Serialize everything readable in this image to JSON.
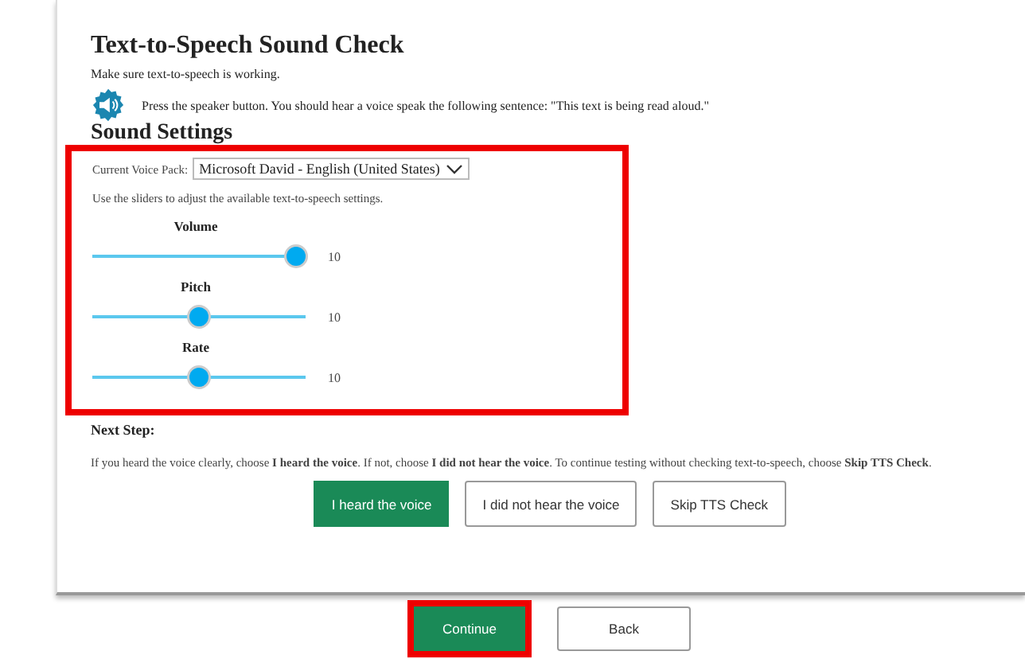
{
  "title": "Text-to-Speech Sound Check",
  "intro": "Make sure text-to-speech is working.",
  "speaker_instruction": "Press the speaker button. You should hear a voice speak the following sentence: \"This text is being read aloud.\"",
  "sound_settings": {
    "heading": "Sound Settings",
    "highlighted": true,
    "voice_pack_label": "Current Voice Pack:",
    "voice_pack_value": "Microsoft David - English (United States)",
    "hint": "Use the sliders to adjust the available text-to-speech settings.",
    "sliders": [
      {
        "label": "Volume",
        "level": 1.0,
        "reading": "10"
      },
      {
        "label": "Pitch",
        "level": 0.5,
        "reading": "10"
      },
      {
        "label": "Rate",
        "level": 0.5,
        "reading": "10"
      }
    ]
  },
  "next_step": {
    "heading": "Next Step:",
    "text": "If you heard the voice clearly, choose **I heard the voice**. If not, choose **I did not hear the voice**. To continue testing without checking text-to-speech, choose **Skip TTS Check**.",
    "buttons": [
      {
        "label": "I heard the voice",
        "kind": "primary",
        "highlighted": false
      },
      {
        "label": "I did not hear the voice",
        "kind": "secondary",
        "highlighted": false
      },
      {
        "label": "Skip TTS Check",
        "kind": "secondary",
        "highlighted": false
      }
    ]
  },
  "footer_buttons": [
    {
      "label": "Continue",
      "kind": "primary",
      "highlighted": true
    },
    {
      "label": "Back",
      "kind": "secondary",
      "highlighted": false
    }
  ]
}
